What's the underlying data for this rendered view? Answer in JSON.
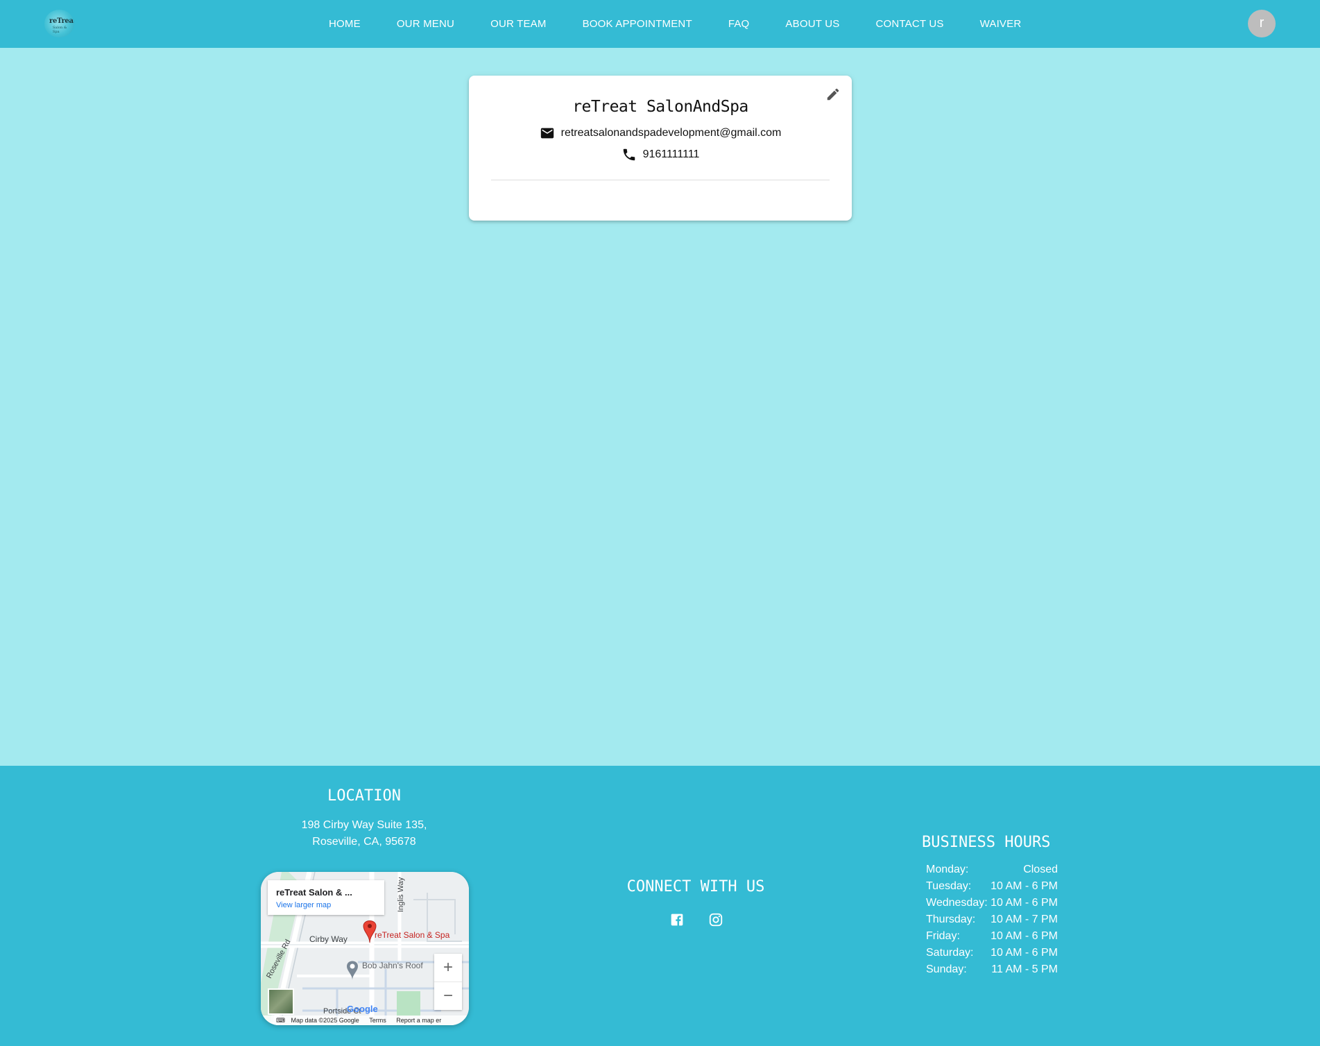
{
  "nav": {
    "logo_text": "reTreat",
    "logo_subtext": "Salon & Spa",
    "links": [
      "HOME",
      "OUR MENU",
      "OUR TEAM",
      "BOOK APPOINTMENT",
      "FAQ",
      "ABOUT US",
      "CONTACT US",
      "WAIVER"
    ],
    "avatar_initial": "r"
  },
  "profile": {
    "name": "reTreat SalonAndSpa",
    "email": "retreatsalonandspadevelopment@gmail.com",
    "phone": "9161111111"
  },
  "footer": {
    "location_title": "LOCATION",
    "address_line1": "198 Cirby Way Suite 135,",
    "address_line2": "Roseville, CA, 95678",
    "map": {
      "place_title": "reTreat Salon & ...",
      "view_larger": "View larger map",
      "marker_label": "reTreat Salon & Spa",
      "poi_label": "Bob Jahn's Roof",
      "streets": [
        "Cirby Way",
        "Roseville Rd",
        "Inglis Way",
        "Portside Ct"
      ],
      "google_logo": "Google",
      "attribution": [
        "Map data ©2025 Google",
        "Terms",
        "Report a map er"
      ]
    },
    "connect_title": "CONNECT WITH US",
    "hours_title": "BUSINESS HOURS",
    "hours": [
      {
        "day": "Monday:",
        "time": "Closed"
      },
      {
        "day": "Tuesday:",
        "time": "10 AM - 6 PM"
      },
      {
        "day": "Wednesday:",
        "time": "10 AM - 6 PM"
      },
      {
        "day": "Thursday:",
        "time": "10 AM - 7 PM"
      },
      {
        "day": "Friday:",
        "time": "10 AM - 6 PM"
      },
      {
        "day": "Saturday:",
        "time": "10 AM - 6 PM"
      },
      {
        "day": "Sunday:",
        "time": "11 AM - 5 PM"
      }
    ]
  }
}
